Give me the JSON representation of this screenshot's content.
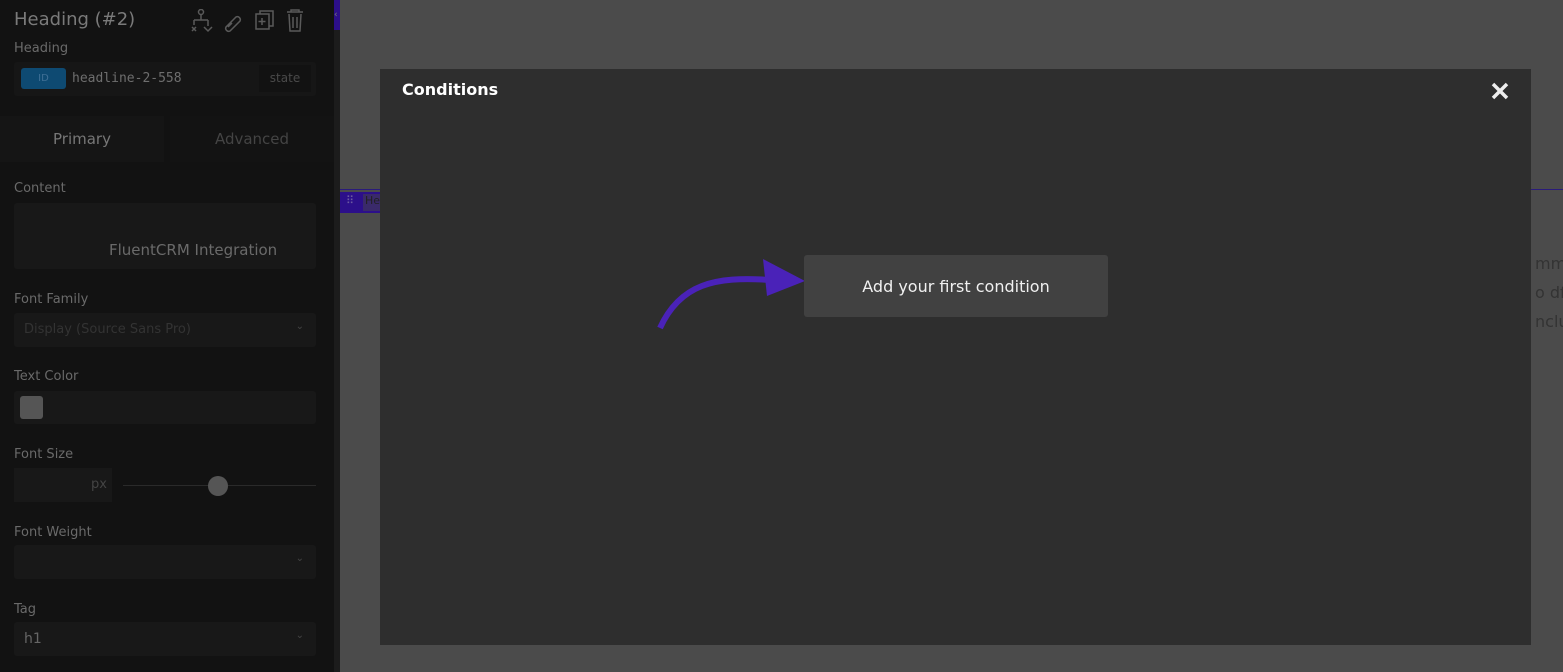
{
  "panel": {
    "title": "Heading (#2)",
    "subtitle": "Heading",
    "id_badge": "ID",
    "id_value": "headline-2-558",
    "state_label": "state",
    "icons": [
      "structure-icon",
      "link-icon",
      "duplicate-icon",
      "trash-icon"
    ],
    "tabs": [
      {
        "label": "Primary",
        "active": true
      },
      {
        "label": "Advanced",
        "active": false
      }
    ],
    "content_label": "Content",
    "content_value": "FluentCRM Integration",
    "font_family_label": "Font Family",
    "font_family_value": "Display (Source Sans Pro)",
    "text_color_label": "Text Color",
    "font_size_label": "Font Size",
    "font_size_unit": "px",
    "font_size_slider_fraction": 0.5,
    "font_weight_label": "Font Weight",
    "tag_label": "Tag",
    "tag_value": "h1"
  },
  "canvas": {
    "handle_text": "He",
    "fragments": [
      "mm",
      "o df",
      "nclu"
    ]
  },
  "modal": {
    "title": "Conditions",
    "add_button": "Add your first condition",
    "arrow_color": "#4a22b8"
  },
  "colors": {
    "accent": "#2c0f8a",
    "id_badge": "#0e4a72"
  }
}
